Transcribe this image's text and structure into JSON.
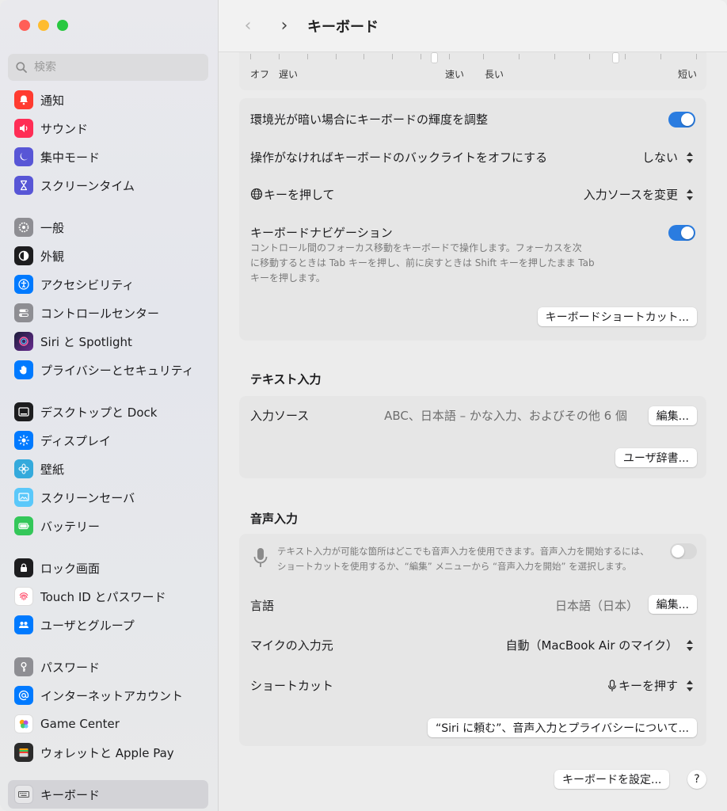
{
  "window": {
    "title": "キーボード"
  },
  "sidebar": {
    "search_placeholder": "検索",
    "items": [
      {
        "label": "通知",
        "icon": "bell-icon",
        "color": "#ff3b30"
      },
      {
        "label": "サウンド",
        "icon": "speaker-icon",
        "color": "#ff2d55"
      },
      {
        "label": "集中モード",
        "icon": "moon-icon",
        "color": "#5856d6"
      },
      {
        "label": "スクリーンタイム",
        "icon": "hourglass-icon",
        "color": "#5856d6"
      },
      {
        "label": "一般",
        "icon": "gear-icon",
        "color": "#8e8e93"
      },
      {
        "label": "外観",
        "icon": "appearance-icon",
        "color": "#1d1d1f"
      },
      {
        "label": "アクセシビリティ",
        "icon": "accessibility-icon",
        "color": "#007aff"
      },
      {
        "label": "コントロールセンター",
        "icon": "control-center-icon",
        "color": "#8e8e93"
      },
      {
        "label": "Siri と Spotlight",
        "icon": "siri-icon",
        "color": "#5b2c8a"
      },
      {
        "label": "プライバシーとセキュリティ",
        "icon": "hand-icon",
        "color": "#007aff"
      },
      {
        "label": "デスクトップと Dock",
        "icon": "dock-icon",
        "color": "#1d1d1f"
      },
      {
        "label": "ディスプレイ",
        "icon": "sun-icon",
        "color": "#007aff"
      },
      {
        "label": "壁紙",
        "icon": "flower-icon",
        "color": "#34aadc"
      },
      {
        "label": "スクリーンセーバ",
        "icon": "screensaver-icon",
        "color": "#5ac8fa"
      },
      {
        "label": "バッテリー",
        "icon": "battery-icon",
        "color": "#34c759"
      },
      {
        "label": "ロック画面",
        "icon": "lock-icon",
        "color": "#1d1d1f"
      },
      {
        "label": "Touch ID とパスワード",
        "icon": "fingerprint-icon",
        "color": "#ffffff"
      },
      {
        "label": "ユーザとグループ",
        "icon": "users-icon",
        "color": "#007aff"
      },
      {
        "label": "パスワード",
        "icon": "key-icon",
        "color": "#8e8e93"
      },
      {
        "label": "インターネットアカウント",
        "icon": "at-icon",
        "color": "#007aff"
      },
      {
        "label": "Game Center",
        "icon": "game-center-icon",
        "color": "#ffffff"
      },
      {
        "label": "ウォレットと Apple Pay",
        "icon": "wallet-icon",
        "color": "#1d1d1f"
      },
      {
        "label": "キーボード",
        "icon": "keyboard-icon",
        "color": "#8e8e93"
      }
    ]
  },
  "toolbar": {
    "back_icon": "chevron-left-icon",
    "forward_icon": "chevron-right-icon"
  },
  "sliders": {
    "repeat": {
      "left": "オフ",
      "mid": "遅い",
      "right": "速い",
      "value": 0.92
    },
    "delay": {
      "left": "長い",
      "right": "短い",
      "value": 0.62
    }
  },
  "keyboard": {
    "brightness_label": "環境光が暗い場合にキーボードの輝度を調整",
    "brightness_on": true,
    "backlight_label": "操作がなければキーボードのバックライトをオフにする",
    "backlight_value": "しない",
    "globe_label": "キーを押して",
    "globe_value": "入力ソースを変更",
    "nav_label": "キーボードナビゲーション",
    "nav_on": true,
    "nav_desc_1": "コントロール間のフォーカス移動をキーボードで操作します。フォーカスを次",
    "nav_desc_2": "に移動するときは Tab キーを押し、前に戻すときは Shift キーを押したまま Tab",
    "nav_desc_3": "キーを押します。",
    "shortcuts_button": "キーボードショートカット..."
  },
  "text_input": {
    "title": "テキスト入力",
    "sources_label": "入力ソース",
    "sources_value": "ABC、日本語 – かな入力、およびその他 6 個",
    "edit_button": "編集...",
    "dictionary_button": "ユーザ辞書..."
  },
  "dictation": {
    "title": "音声入力",
    "desc_1": "テキスト入力が可能な箇所はどこでも音声入力を使用できます。音声入力を開始するには、",
    "desc_2": "ショートカットを使用するか、“編集” メニューから “音声入力を開始” を選択します。",
    "enabled": false,
    "language_label": "言語",
    "language_value": "日本語（日本）",
    "edit_button": "編集...",
    "mic_label": "マイクの入力元",
    "mic_value": "自動（MacBook Air のマイク）",
    "shortcut_label": "ショートカット",
    "shortcut_value": "キーを押す",
    "privacy_button": "“Siri に頼む”、音声入力とプライバシーについて..."
  },
  "footer": {
    "setup_button": "キーボードを設定...",
    "help_label": "?"
  },
  "colors": {
    "accent": "#2a7ce0"
  }
}
